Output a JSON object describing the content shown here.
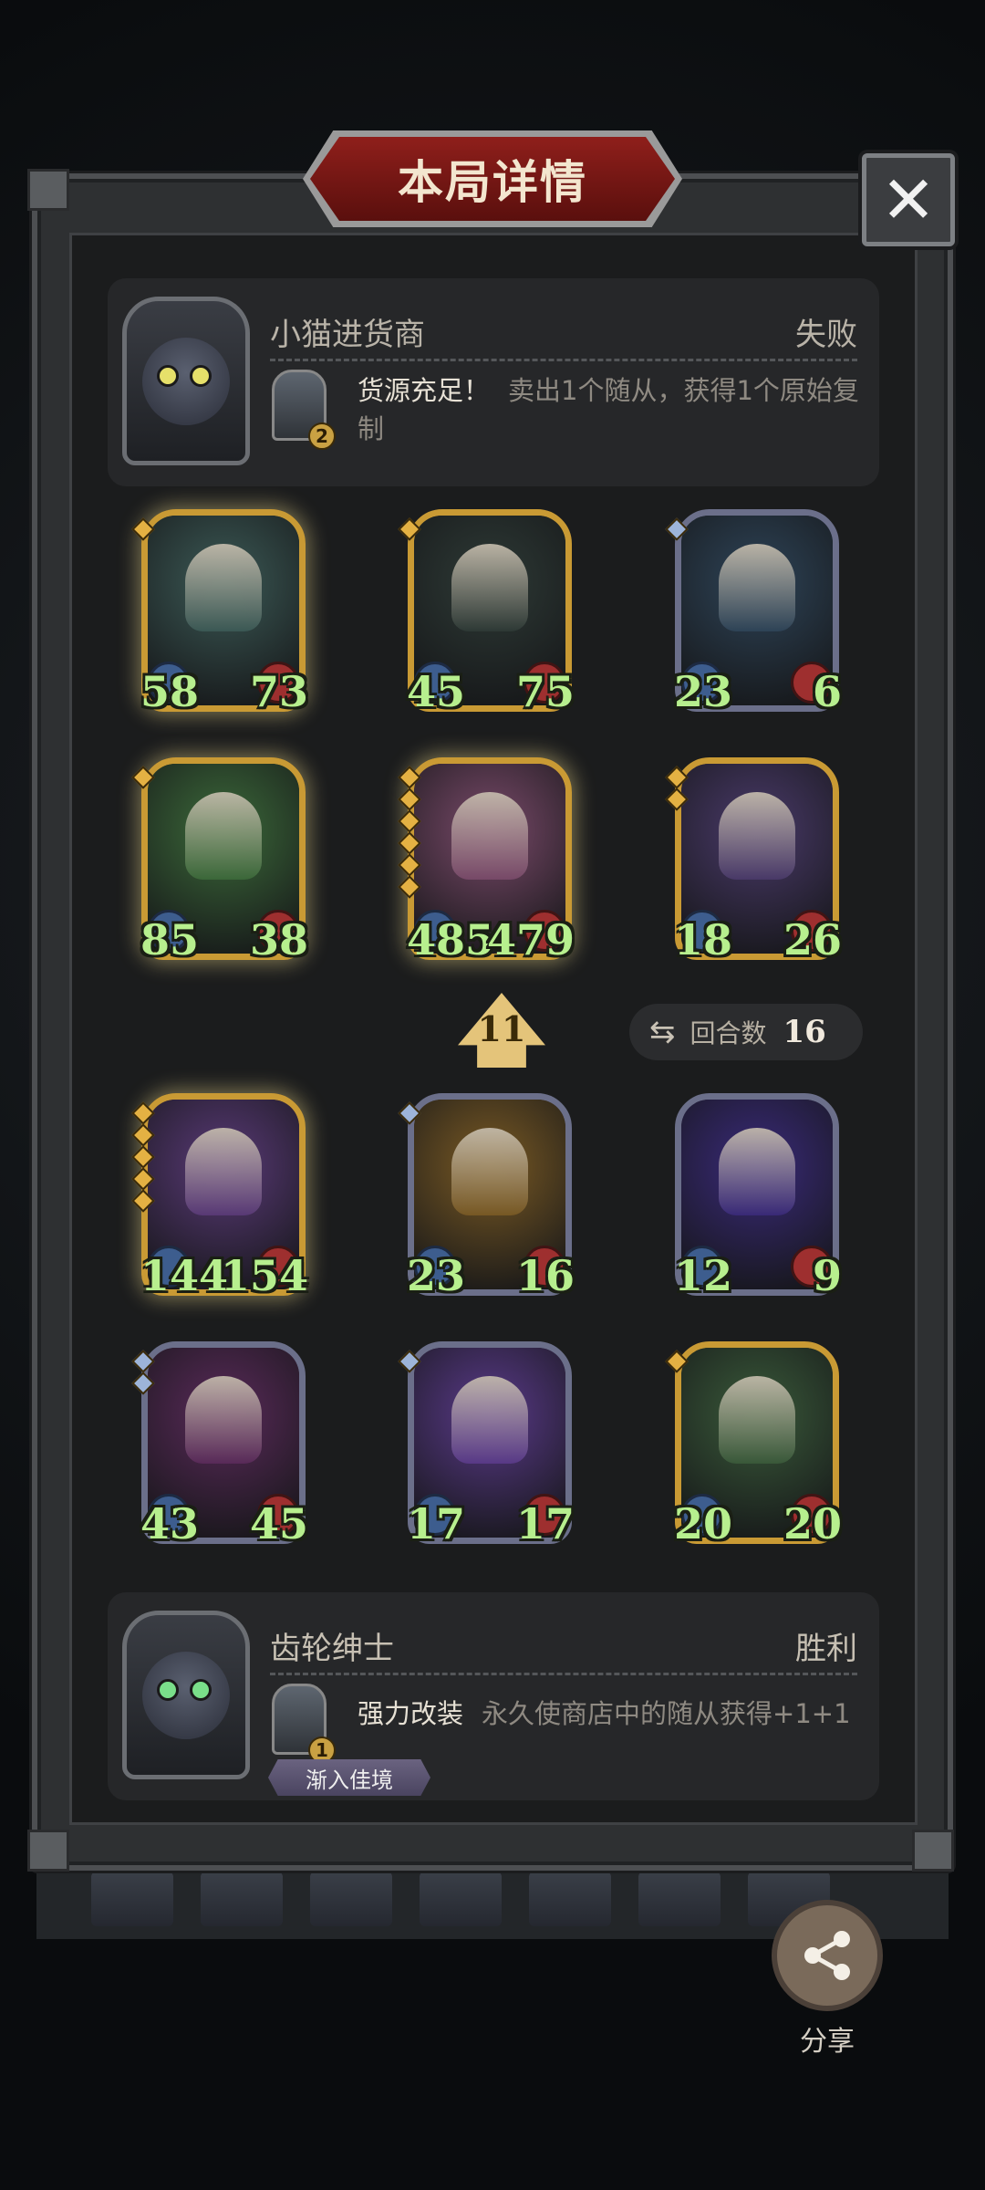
{
  "title": "本局详情",
  "close_label": "✕",
  "player_top": {
    "name": "小猫进货商",
    "result": "失败",
    "power_badge": "2",
    "power_name": "货源充足！",
    "power_desc": "卖出1个随从，获得1个原始复制"
  },
  "board_top": [
    {
      "atk": "58",
      "hp": "73",
      "frame": "gold",
      "gems": 1,
      "gem_color": "gold",
      "art_color": "#3c5a56"
    },
    {
      "atk": "45",
      "hp": "75",
      "frame": "goldplain",
      "gems": 1,
      "gem_color": "gold",
      "art_color": "#2e3a36"
    },
    {
      "atk": "23",
      "hp": "6",
      "frame": "silver",
      "gems": 1,
      "gem_color": "blue",
      "art_color": "#2e4458"
    },
    {
      "atk": "85",
      "hp": "38",
      "frame": "gold",
      "gems": 1,
      "gem_color": "gold",
      "art_color": "#3c6a3a"
    },
    {
      "atk": "485",
      "hp": "479",
      "frame": "gold",
      "gems": 6,
      "gem_color": "gold",
      "art_color": "#7a4a6a"
    },
    {
      "atk": "18",
      "hp": "26",
      "frame": "goldplain",
      "gems": 2,
      "gem_color": "gold",
      "art_color": "#4a3a6a"
    }
  ],
  "level_badge": "11",
  "rounds": {
    "label": "回合数",
    "value": "16"
  },
  "board_bottom": [
    {
      "atk": "144",
      "hp": "154",
      "frame": "gold",
      "gems": 5,
      "gem_color": "gold",
      "art_color": "#5a3a78"
    },
    {
      "atk": "23",
      "hp": "16",
      "frame": "silver",
      "gems": 1,
      "gem_color": "blue",
      "art_color": "#7a5a24"
    },
    {
      "atk": "12",
      "hp": "9",
      "frame": "silver",
      "gems": 0,
      "gem_color": "blue",
      "art_color": "#3a2a7a"
    },
    {
      "atk": "43",
      "hp": "45",
      "frame": "silver",
      "gems": 2,
      "gem_color": "blue",
      "art_color": "#5a2a5a"
    },
    {
      "atk": "17",
      "hp": "17",
      "frame": "silver",
      "gems": 1,
      "gem_color": "blue",
      "art_color": "#5a3a8a"
    },
    {
      "atk": "20",
      "hp": "20",
      "frame": "goldplain",
      "gems": 1,
      "gem_color": "gold",
      "art_color": "#3a5a3a"
    }
  ],
  "player_bottom": {
    "name": "齿轮绅士",
    "result": "胜利",
    "power_badge": "1",
    "power_name": "强力改装",
    "power_desc": "永久使商店中的随从获得+1+1",
    "tag": "渐入佳境"
  },
  "share_label": "分享",
  "icons": {
    "close": "close-icon",
    "share": "share-icon",
    "rounds": "refresh-icon",
    "level": "arrow-up-icon"
  },
  "colors": {
    "stat_text": "#b7ef8e",
    "title_red": "#8f1f1b",
    "frame_gold": "#c99a34",
    "frame_silver": "#6b6f8a"
  }
}
